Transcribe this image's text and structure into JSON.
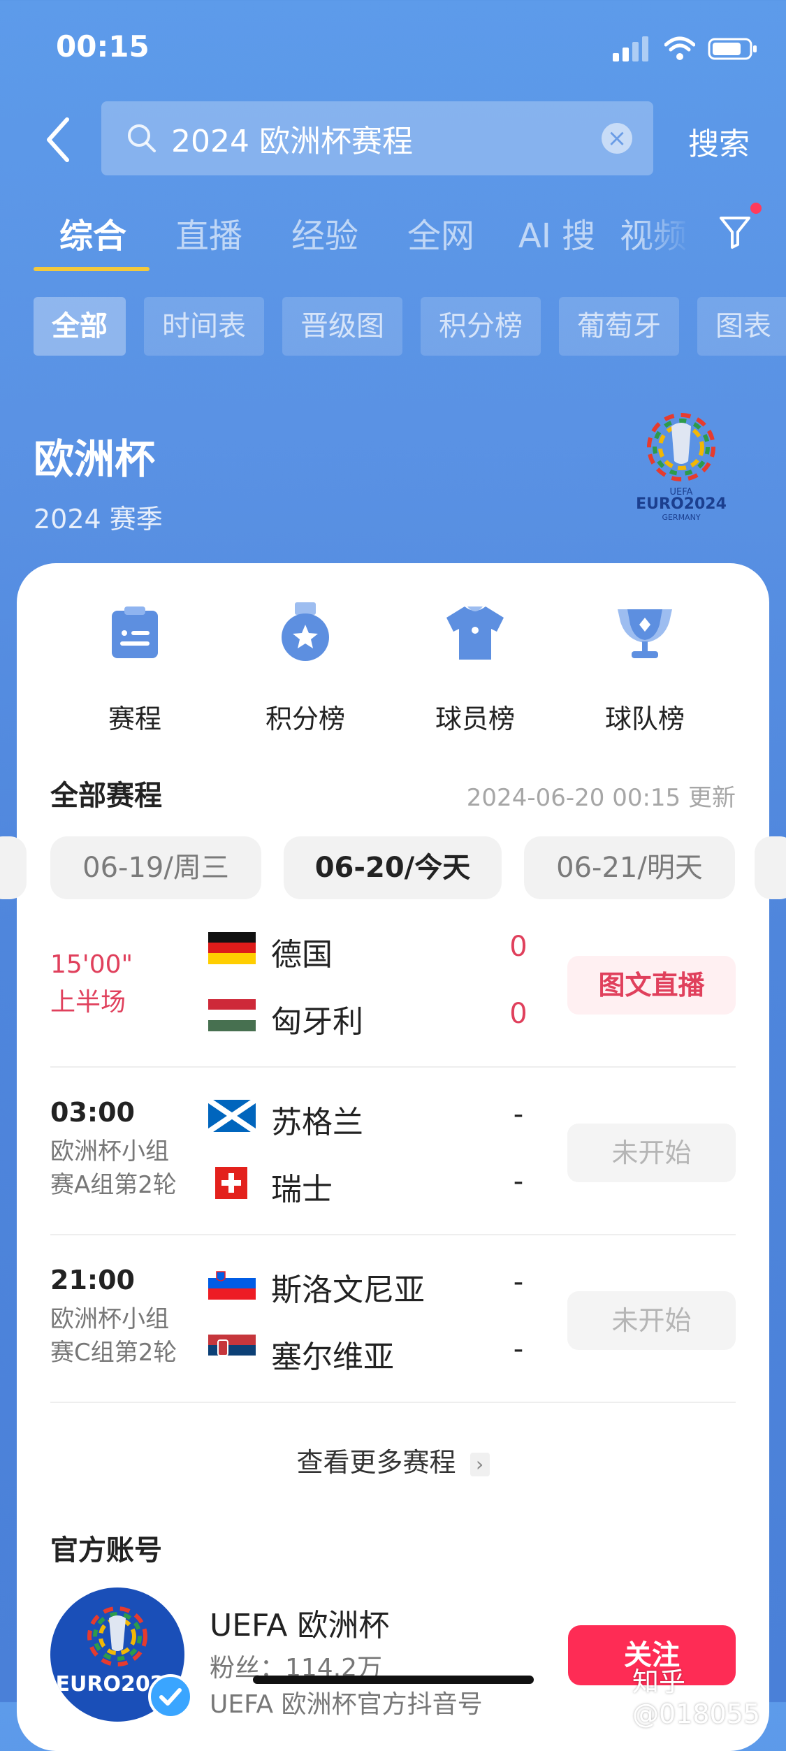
{
  "status_bar": {
    "time": "00:15"
  },
  "search": {
    "query": "2024 欧洲杯赛程",
    "button": "搜索"
  },
  "tabs": [
    {
      "label": "综合"
    },
    {
      "label": "直播"
    },
    {
      "label": "经验"
    },
    {
      "label": "全网"
    },
    {
      "label": "AI 搜"
    },
    {
      "label": "视频"
    }
  ],
  "chips": [
    {
      "label": "全部"
    },
    {
      "label": "时间表"
    },
    {
      "label": "晋级图"
    },
    {
      "label": "积分榜"
    },
    {
      "label": "葡萄牙"
    },
    {
      "label": "图表"
    }
  ],
  "league": {
    "title": "欧洲杯",
    "season": "2024 赛季",
    "logo_text": "EURO2024",
    "logo_sub": "GERMANY",
    "logo_top": "UEFA"
  },
  "quick_actions": [
    {
      "label": "赛程",
      "icon": "schedule-icon"
    },
    {
      "label": "积分榜",
      "icon": "medal-icon"
    },
    {
      "label": "球员榜",
      "icon": "jersey-icon"
    },
    {
      "label": "球队榜",
      "icon": "trophy-icon"
    }
  ],
  "schedule": {
    "title": "全部赛程",
    "updated": "2024-06-20 00:15 更新",
    "dates": [
      {
        "label": "06-19/周三"
      },
      {
        "label": "06-20/今天"
      },
      {
        "label": "06-21/明天"
      }
    ],
    "matches": [
      {
        "time": "15'00\"",
        "phase": "上半场",
        "home": "德国",
        "away": "匈牙利",
        "home_score": "0",
        "away_score": "0",
        "button": "图文直播"
      },
      {
        "time": "03:00",
        "round_line1": "欧洲杯小组",
        "round_line2": "赛A组第2轮",
        "home": "苏格兰",
        "away": "瑞士",
        "home_score": "-",
        "away_score": "-",
        "button": "未开始"
      },
      {
        "time": "21:00",
        "round_line1": "欧洲杯小组",
        "round_line2": "赛C组第2轮",
        "home": "斯洛文尼亚",
        "away": "塞尔维亚",
        "home_score": "-",
        "away_score": "-",
        "button": "未开始"
      }
    ],
    "more": "查看更多赛程"
  },
  "official": {
    "title": "官方账号",
    "name": "UEFA 欧洲杯",
    "fans": "粉丝：114.2万",
    "desc": "UEFA 欧洲杯官方抖音号",
    "follow": "关注",
    "avatar_text": "EURO2024"
  },
  "watermark": "知乎 @018055",
  "colors": {
    "accent": "#fe2c55",
    "live": "#e0405c",
    "tab_underline": "#f3c93c"
  }
}
